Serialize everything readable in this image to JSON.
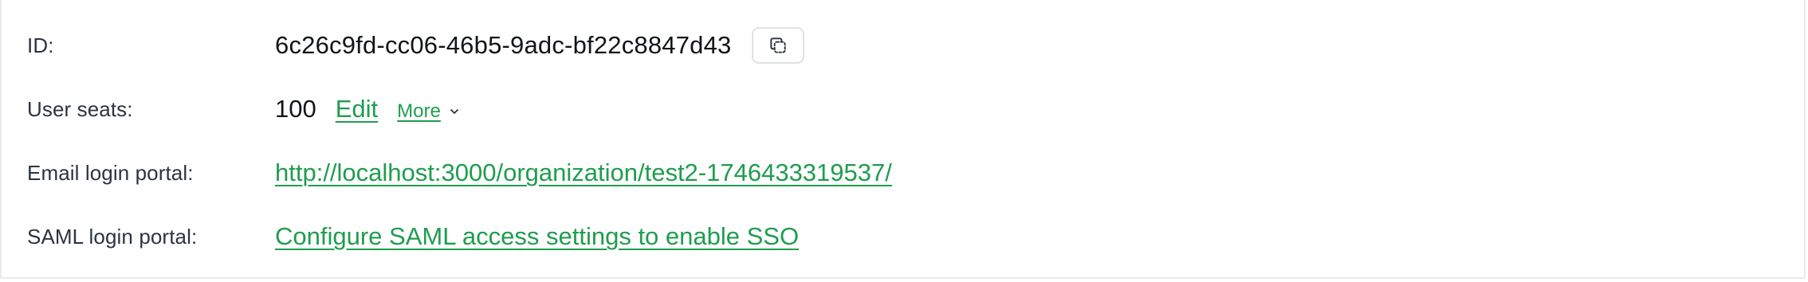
{
  "fields": {
    "id": {
      "label": "ID:",
      "value": "6c26c9fd-cc06-46b5-9adc-bf22c8847d43",
      "copy_icon": "copy-icon"
    },
    "seats": {
      "label": "User seats:",
      "value": "100",
      "edit_label": "Edit",
      "more_label": "More",
      "more_icon": "chevron-down-icon"
    },
    "email_portal": {
      "label": "Email login portal:",
      "link": "http://localhost:3000/organization/test2-1746433319537/"
    },
    "saml_portal": {
      "label": "SAML login portal:",
      "link": "Configure SAML access settings to enable SSO"
    }
  },
  "colors": {
    "link": "#1f9d4f",
    "label": "#2c3441",
    "text": "#111418",
    "border": "#e8e9eb"
  }
}
